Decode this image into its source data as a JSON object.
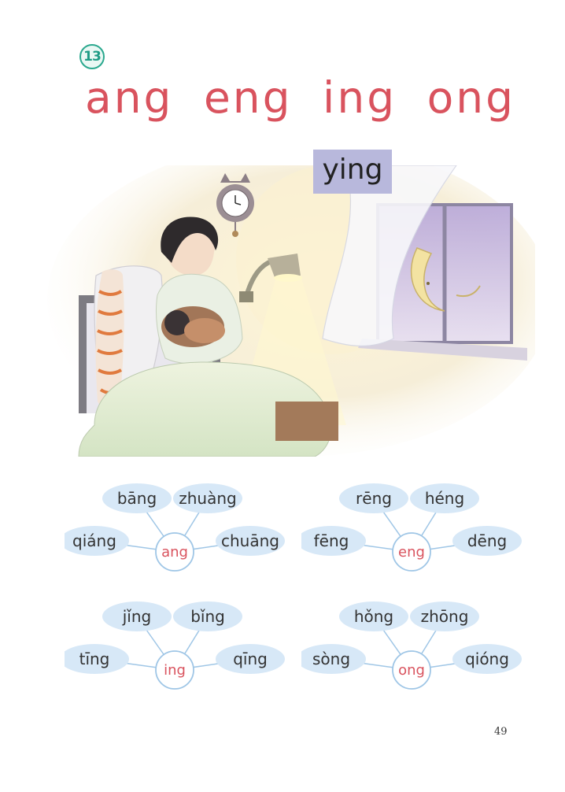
{
  "lesson": {
    "number": "13",
    "title": "ang eng ing ong",
    "syllable": "ying"
  },
  "colors": {
    "title_red": "#d9535e",
    "ellipse_blue": "#d7e8f7",
    "badge_green": "#2aa88e",
    "syllable_box": "#b8b8dc"
  },
  "webs": [
    {
      "center": "ang",
      "words": [
        "bāng",
        "zhuàng",
        "qiáng",
        "chuāng"
      ]
    },
    {
      "center": "eng",
      "words": [
        "rēng",
        "héng",
        "fēng",
        "dēng"
      ]
    },
    {
      "center": "ing",
      "words": [
        "jǐng",
        "bǐng",
        "tīng",
        "qīng"
      ]
    },
    {
      "center": "ong",
      "words": [
        "hǒng",
        "zhōng",
        "sòng",
        "qióng"
      ]
    }
  ],
  "page": {
    "number": "49"
  }
}
